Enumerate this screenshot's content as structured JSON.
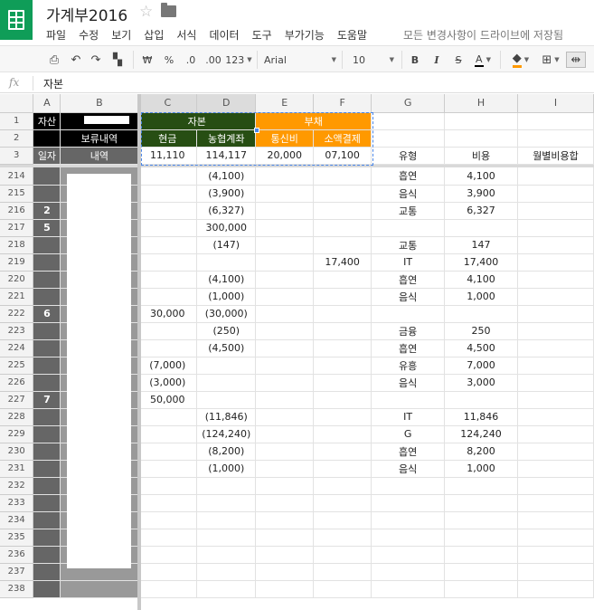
{
  "app": {
    "doc_title": "가계부2016",
    "star_icon": "star-icon",
    "folder_icon": "folder-icon",
    "menu": [
      "파일",
      "수정",
      "보기",
      "삽입",
      "서식",
      "데이터",
      "도구",
      "부가기능",
      "도움말"
    ],
    "save_status": "모든 변경사항이 드라이브에 저장됨"
  },
  "toolbar": {
    "currency": "₩",
    "percent": "%",
    "dec_decrease": ".0",
    "dec_increase": ".00",
    "more_formats": "123",
    "font": "Arial",
    "font_size": "10",
    "bold": "B",
    "italic": "I",
    "strike": "S",
    "text_color": "A"
  },
  "formula_bar": {
    "fx_label": "fx",
    "value": "자본"
  },
  "columns": [
    "",
    "A",
    "B",
    "C",
    "D",
    "E",
    "F",
    "G",
    "H",
    "I"
  ],
  "header_rows": [
    {
      "num": "1",
      "A": "자산",
      "B": "",
      "CD": "자본",
      "EF": "부채"
    },
    {
      "num": "2",
      "A": "",
      "B": "보류내역",
      "C": "현금",
      "D": "농협계좌",
      "E": "통신비",
      "F": "소액결제"
    },
    {
      "num": "3",
      "A": "일자",
      "B": "내역",
      "C": "11,110",
      "D": "114,117",
      "E": "20,000",
      "F": "07,100",
      "G": "유형",
      "H": "비용",
      "I": "월별비용합"
    }
  ],
  "rows": [
    {
      "num": "214",
      "A": "",
      "C": "",
      "D": "(4,100)",
      "E": "",
      "F": "",
      "G": "흡연",
      "H": "4,100",
      "I": ""
    },
    {
      "num": "215",
      "A": "",
      "C": "",
      "D": "(3,900)",
      "E": "",
      "F": "",
      "G": "음식",
      "H": "3,900",
      "I": ""
    },
    {
      "num": "216",
      "A": "2",
      "C": "",
      "D": "(6,327)",
      "E": "",
      "F": "",
      "G": "교통",
      "H": "6,327",
      "I": ""
    },
    {
      "num": "217",
      "A": "5",
      "C": "",
      "D": "300,000",
      "E": "",
      "F": "",
      "G": "",
      "H": "",
      "I": ""
    },
    {
      "num": "218",
      "A": "",
      "C": "",
      "D": "(147)",
      "E": "",
      "F": "",
      "G": "교통",
      "H": "147",
      "I": ""
    },
    {
      "num": "219",
      "A": "",
      "C": "",
      "D": "",
      "E": "",
      "F": "17,400",
      "G": "IT",
      "H": "17,400",
      "I": ""
    },
    {
      "num": "220",
      "A": "",
      "C": "",
      "D": "(4,100)",
      "E": "",
      "F": "",
      "G": "흡연",
      "H": "4,100",
      "I": ""
    },
    {
      "num": "221",
      "A": "",
      "C": "",
      "D": "(1,000)",
      "E": "",
      "F": "",
      "G": "음식",
      "H": "1,000",
      "I": ""
    },
    {
      "num": "222",
      "A": "6",
      "C": "30,000",
      "D": "(30,000)",
      "E": "",
      "F": "",
      "G": "",
      "H": "",
      "I": ""
    },
    {
      "num": "223",
      "A": "",
      "C": "",
      "D": "(250)",
      "E": "",
      "F": "",
      "G": "금융",
      "H": "250",
      "I": ""
    },
    {
      "num": "224",
      "A": "",
      "C": "",
      "D": "(4,500)",
      "E": "",
      "F": "",
      "G": "흡연",
      "H": "4,500",
      "I": ""
    },
    {
      "num": "225",
      "A": "",
      "C": "(7,000)",
      "D": "",
      "E": "",
      "F": "",
      "G": "유흥",
      "H": "7,000",
      "I": ""
    },
    {
      "num": "226",
      "A": "",
      "C": "(3,000)",
      "D": "",
      "E": "",
      "F": "",
      "G": "음식",
      "H": "3,000",
      "I": ""
    },
    {
      "num": "227",
      "A": "7",
      "C": "50,000",
      "D": "",
      "E": "",
      "F": "",
      "G": "",
      "H": "",
      "I": ""
    },
    {
      "num": "228",
      "A": "",
      "C": "",
      "D": "(11,846)",
      "E": "",
      "F": "",
      "G": "IT",
      "H": "11,846",
      "I": ""
    },
    {
      "num": "229",
      "A": "",
      "C": "",
      "D": "(124,240)",
      "E": "",
      "F": "",
      "G": "G",
      "H": "124,240",
      "I": ""
    },
    {
      "num": "230",
      "A": "",
      "C": "",
      "D": "(8,200)",
      "E": "",
      "F": "",
      "G": "흡연",
      "H": "8,200",
      "I": ""
    },
    {
      "num": "231",
      "A": "",
      "C": "",
      "D": "(1,000)",
      "E": "",
      "F": "",
      "G": "음식",
      "H": "1,000",
      "I": ""
    },
    {
      "num": "232",
      "A": "",
      "C": "",
      "D": "",
      "E": "",
      "F": "",
      "G": "",
      "H": "",
      "I": ""
    },
    {
      "num": "233",
      "A": "",
      "C": "",
      "D": "",
      "E": "",
      "F": "",
      "G": "",
      "H": "",
      "I": ""
    },
    {
      "num": "234",
      "A": "",
      "C": "",
      "D": "",
      "E": "",
      "F": "",
      "G": "",
      "H": "",
      "I": ""
    },
    {
      "num": "235",
      "A": "",
      "C": "",
      "D": "",
      "E": "",
      "F": "",
      "G": "",
      "H": "",
      "I": ""
    },
    {
      "num": "236",
      "A": "",
      "C": "",
      "D": "",
      "E": "",
      "F": "",
      "G": "",
      "H": "",
      "I": ""
    },
    {
      "num": "237",
      "A": "",
      "C": "",
      "D": "",
      "E": "",
      "F": "",
      "G": "",
      "H": "",
      "I": ""
    },
    {
      "num": "238",
      "A": "",
      "C": "",
      "D": "",
      "E": "",
      "F": "",
      "G": "",
      "H": "",
      "I": ""
    }
  ],
  "colors": {
    "brand": "#0f9d58",
    "equity_header": "#274e13",
    "liability_header": "#ff9900",
    "date_column": "#666666",
    "detail_column": "#999999",
    "selection": "#4a86e8"
  }
}
